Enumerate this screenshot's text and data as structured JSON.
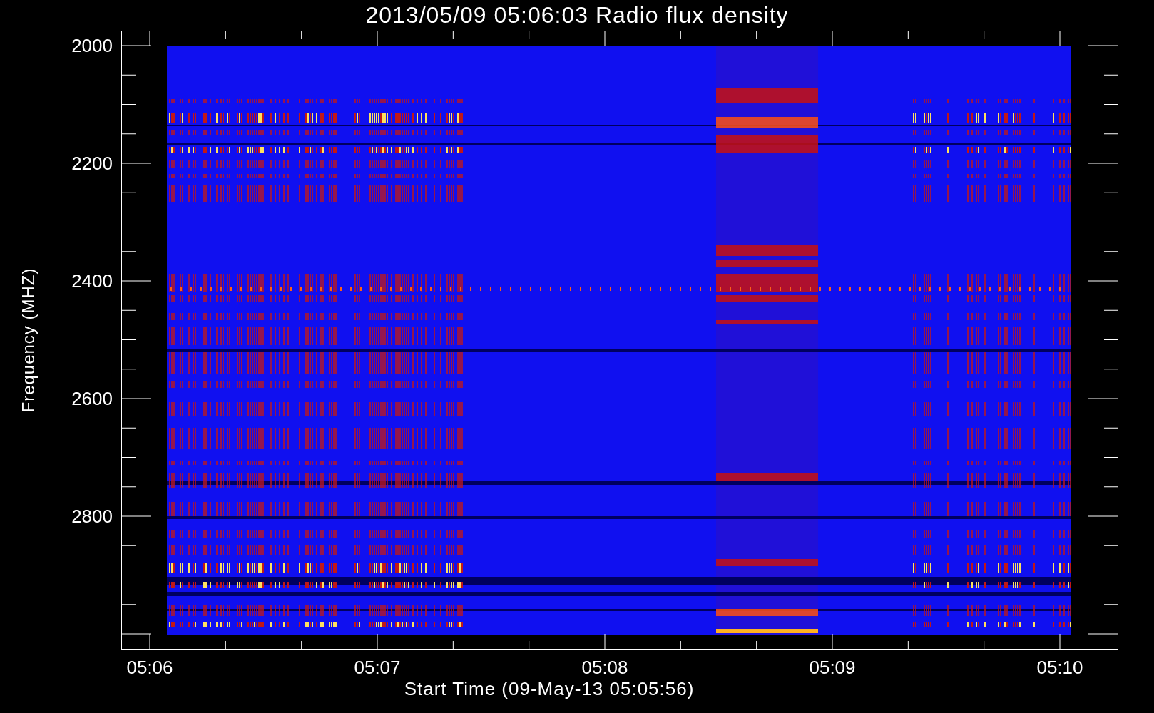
{
  "title": "2013/05/09 05:06:03 Radio flux density",
  "y_axis": {
    "label": "Frequency (MHZ)",
    "ticks": [
      "2000",
      "2200",
      "2400",
      "2600",
      "2800"
    ]
  },
  "x_axis": {
    "label": "Start Time (09-May-13 05:05:56)",
    "ticks": [
      "05:06",
      "05:07",
      "05:08",
      "05:09",
      "05:10"
    ]
  }
}
